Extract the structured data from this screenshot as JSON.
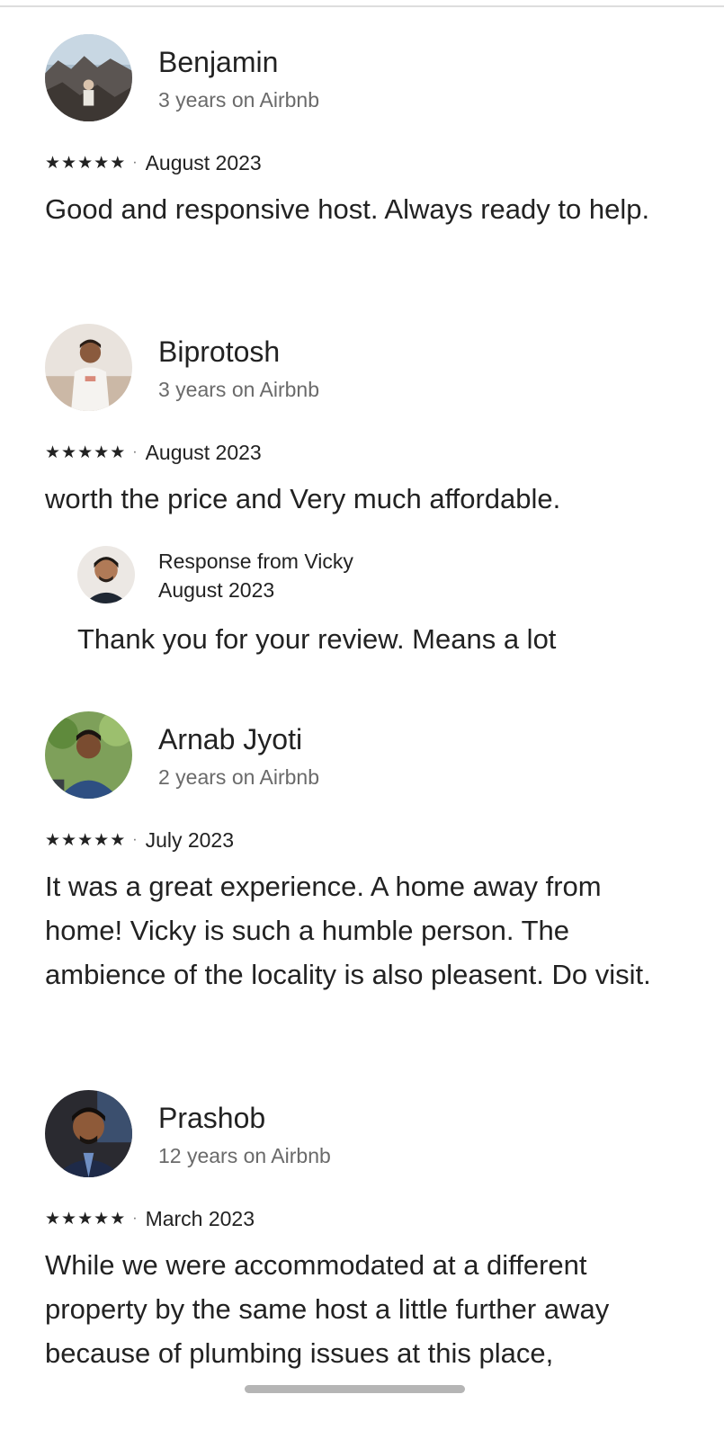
{
  "reviews": [
    {
      "name": "Benjamin",
      "tenure": "3 years on Airbnb",
      "rating": 5,
      "date": "August 2023",
      "text": "Good and responsive host. Always ready to help."
    },
    {
      "name": "Biprotosh",
      "tenure": "3 years on Airbnb",
      "rating": 5,
      "date": "August 2023",
      "text": "worth the price and Very much affordable.",
      "response": {
        "title": "Response from Vicky",
        "date": "August 2023",
        "text": "Thank you for your review. Means a lot"
      }
    },
    {
      "name": "Arnab Jyoti",
      "tenure": "2 years on Airbnb",
      "rating": 5,
      "date": "July 2023",
      "text": "It was a great experience. A home away from home! Vicky is such a humble person. The ambience of the locality is also pleasent. Do visit."
    },
    {
      "name": "Prashob",
      "tenure": "12 years on Airbnb",
      "rating": 5,
      "date": "March 2023",
      "text": "While we were accommodated at a different property by the same host a little further away because of plumbing issues at this place,"
    }
  ],
  "icons": {
    "star": "star-icon",
    "separator": "·"
  },
  "colors": {
    "text": "#222222",
    "secondary": "#6a6a6a",
    "divider": "#dddddd"
  }
}
